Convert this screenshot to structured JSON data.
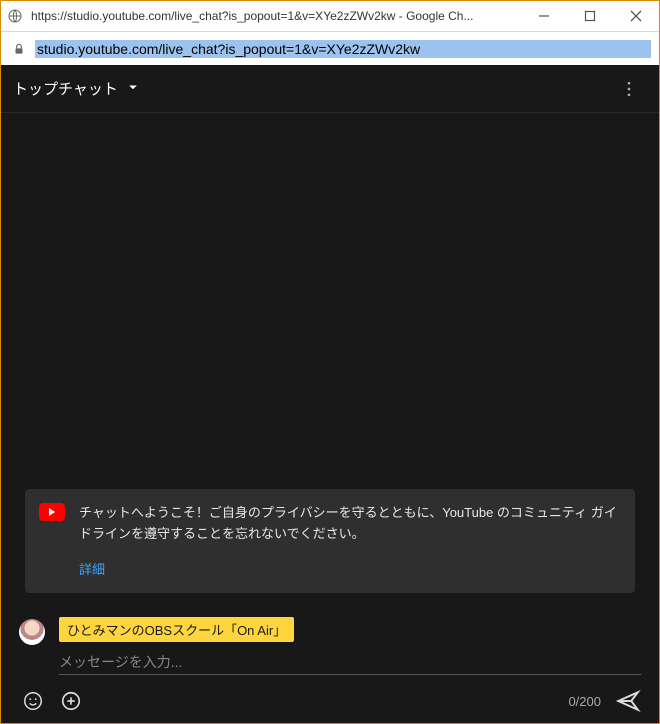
{
  "window": {
    "title": "https://studio.youtube.com/live_chat?is_popout=1&v=XYe2zZWv2kw - Google Ch..."
  },
  "address": {
    "url": "studio.youtube.com/live_chat?is_popout=1&v=XYe2zZWv2kw"
  },
  "chat": {
    "header_label": "トップチャット",
    "notice_text": "チャットへようこそ！ご自身のプライバシーを守るとともに、YouTube のコミュニティ ガイドラインを遵守することを忘れないでください。",
    "notice_link": "詳細"
  },
  "composer": {
    "username": "ひとみマンのOBSスクール「On Air」",
    "placeholder": "メッセージを入力...",
    "counter": "0/200"
  }
}
